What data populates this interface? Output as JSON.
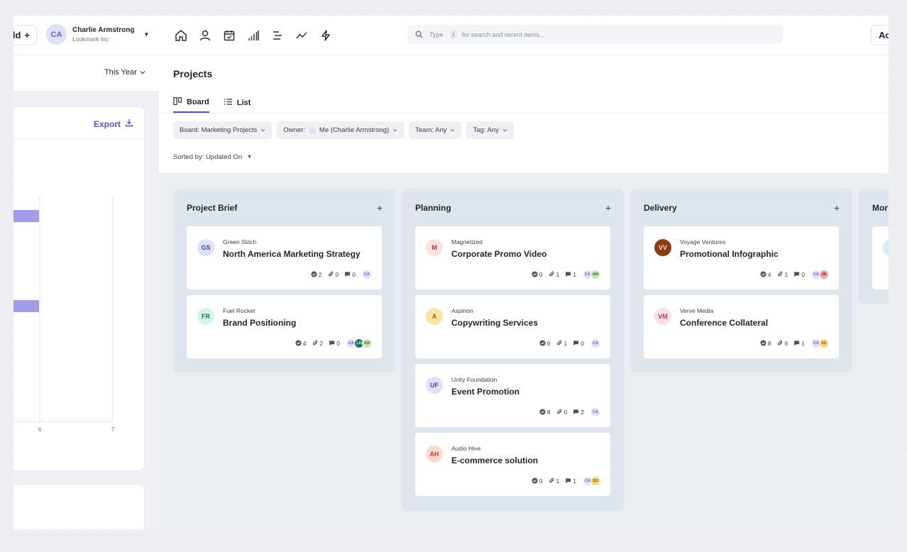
{
  "topbar": {
    "add_label": "dd",
    "add_plus": "+",
    "user": {
      "initials": "CA",
      "name": "Charlie Armstrong",
      "org": "Lookmark Inc"
    },
    "nav_icons": [
      "home-icon",
      "person-icon",
      "calendar-icon",
      "bar-chart-icon",
      "list-align-icon",
      "trend-line-icon",
      "lightning-icon"
    ],
    "search": {
      "prefix": "Type",
      "key": "/",
      "placeholder": "for search and recent items..."
    },
    "action_label": "Ac"
  },
  "left_panel": {
    "period": "This Year",
    "export_label": "Export",
    "chart_data": {
      "type": "bar",
      "orientation": "horizontal",
      "x_ticks": [
        "6",
        "7"
      ],
      "bar_color": "#a39ce8"
    }
  },
  "header": {
    "title": "Projects",
    "tabs": [
      {
        "label": "Board",
        "active": true
      },
      {
        "label": "List",
        "active": false
      }
    ],
    "filters": {
      "board": "Board: Marketing Projects",
      "owner_prefix": "Owner:",
      "owner_value": "Me (Charlie Armstrong)",
      "team": "Team: Any",
      "tag": "Tag: Any"
    },
    "sort_label": "Sorted by: Updated On"
  },
  "board": {
    "columns": [
      {
        "name": "Project Brief",
        "cards": [
          {
            "initials": "GS",
            "client": "Green Stitch",
            "title": "North America Marketing Strategy",
            "tasks": "2",
            "attachments": "0",
            "comments": "0",
            "members": [
              "CA"
            ]
          },
          {
            "initials": "FR",
            "client": "Fuel Rocket",
            "title": "Brand Positioning",
            "tasks": "4",
            "attachments": "2",
            "comments": "0",
            "members": [
              "CA",
              "LD",
              "AW"
            ]
          }
        ]
      },
      {
        "name": "Planning",
        "cards": [
          {
            "initials": "M",
            "client": "Magnetized",
            "title": "Corporate Promo Video",
            "tasks": "0",
            "attachments": "1",
            "comments": "1",
            "members": [
              "CA",
              "AW"
            ]
          },
          {
            "initials": "A",
            "client": "Aspirion",
            "title": "Copywriting Services",
            "tasks": "6",
            "attachments": "1",
            "comments": "0",
            "members": [
              "CA"
            ]
          },
          {
            "initials": "UF",
            "client": "Unity Foundation",
            "title": "Event Promotion",
            "tasks": "8",
            "attachments": "0",
            "comments": "2",
            "members": [
              "CA"
            ]
          },
          {
            "initials": "AH",
            "client": "Audio Hive",
            "title": "E-commerce solution",
            "tasks": "0",
            "attachments": "1",
            "comments": "1",
            "members": [
              "CA",
              "SD"
            ]
          }
        ]
      },
      {
        "name": "Delivery",
        "cards": [
          {
            "initials": "VV",
            "client": "Voyage Ventures",
            "title": "Promotional Infographic",
            "tasks": "4",
            "attachments": "1",
            "comments": "0",
            "members": [
              "CA",
              "JR"
            ]
          },
          {
            "initials": "VM",
            "client": "Verve Media",
            "title": "Conference Collateral",
            "tasks": "8",
            "attachments": "6",
            "comments": "1",
            "members": [
              "CA",
              "SD"
            ]
          }
        ]
      },
      {
        "name": "Mor",
        "cards": []
      }
    ]
  },
  "colors": {
    "accent": "#5b4fd0",
    "column_bg": "#dfe5ec",
    "GS": "#dfe0fb",
    "FR": "#d3f2ec",
    "M": "#fde1e1",
    "A": "#fbe3a0",
    "UF": "#dfe0fb",
    "AH": "#fdd9d4",
    "VV": "#8b3d12",
    "VM": "#fbdde8"
  }
}
